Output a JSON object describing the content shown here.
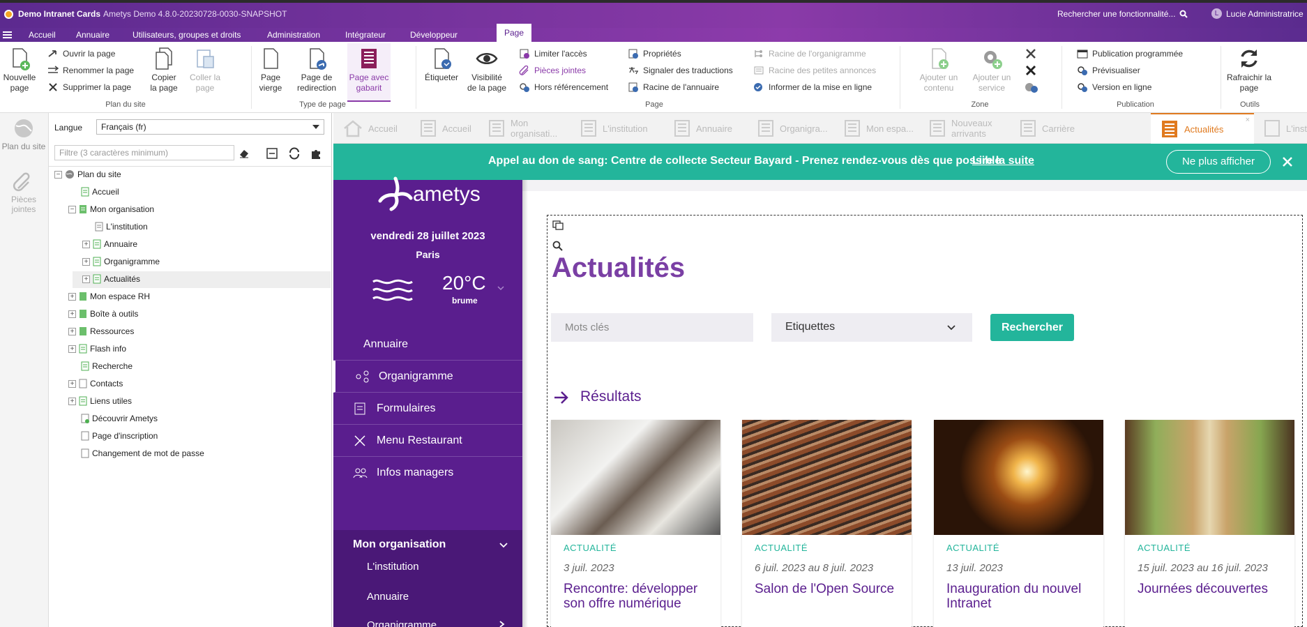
{
  "titlebar": {
    "app_name": "Demo Intranet Cards",
    "version": "Ametys Demo 4.8.0-20230728-0030-SNAPSHOT",
    "search_placeholder": "Rechercher une fonctionnalité...",
    "user_initial": "L",
    "user_name": "Lucie Administratrice"
  },
  "menu": {
    "items": [
      "Accueil",
      "Annuaire",
      "Utilisateurs, groupes et droits",
      "Administration",
      "Intégrateur",
      "Développeur"
    ],
    "active_tab": "Page"
  },
  "ribbon": {
    "plan": {
      "new_page": "Nouvelle page",
      "open": "Ouvrir la page",
      "rename": "Renommer la page",
      "delete": "Supprimer la page",
      "copy": "Copier la page",
      "paste": "Coller la page",
      "group": "Plan du site"
    },
    "type": {
      "blank": "Page vierge",
      "redirect": "Page de redirection",
      "template": "Page avec gabarit",
      "group": "Type de page"
    },
    "page": {
      "tag": "Étiqueter",
      "visibility": "Visibilité de la page",
      "limit_access": "Limiter l'accès",
      "attachments": "Pièces jointes",
      "no_ref": "Hors référencement",
      "properties": "Propriétés",
      "translations": "Signaler des traductions",
      "directory_root": "Racine de l'annuaire",
      "org_root": "Racine de l'organigramme",
      "ads_root": "Racine des petites annonces",
      "notify_online": "Informer de la mise en ligne",
      "group": "Page"
    },
    "zone": {
      "add_content": "Ajouter un contenu",
      "add_service": "Ajouter un service",
      "group": "Zone"
    },
    "publication": {
      "scheduled": "Publication programmée",
      "preview": "Prévisualiser",
      "online": "Version en ligne",
      "group": "Publication"
    },
    "tools": {
      "refresh": "Rafraichir la page",
      "group": "Outils"
    }
  },
  "sidebar": {
    "sitemap": "Plan du site",
    "attachments": "Pièces jointes"
  },
  "tree_panel": {
    "language_label": "Langue",
    "language_value": "Français (fr)",
    "filter_placeholder": "Filtre (3 caractères minimum)",
    "nodes": [
      {
        "label": "Plan du site"
      },
      {
        "label": "Accueil"
      },
      {
        "label": "Mon organisation"
      },
      {
        "label": "L'institution"
      },
      {
        "label": "Annuaire"
      },
      {
        "label": "Organigramme"
      },
      {
        "label": "Actualités"
      },
      {
        "label": "Mon espace RH"
      },
      {
        "label": "Boîte à outils"
      },
      {
        "label": "Ressources"
      },
      {
        "label": "Flash info"
      },
      {
        "label": "Recherche"
      },
      {
        "label": "Contacts"
      },
      {
        "label": "Liens utiles"
      },
      {
        "label": "Découvrir Ametys"
      },
      {
        "label": "Page d'inscription"
      },
      {
        "label": "Changement de mot de passe"
      }
    ]
  },
  "tabs": [
    "Accueil",
    "Accueil",
    "Mon organisati...",
    "L'institution",
    "Annuaire",
    "Organigra...",
    "Mon espa...",
    "Nouveaux arrivants",
    "Carrière",
    "Actualités",
    "L'institu..."
  ],
  "banner": {
    "text": "Appel au don de sang: Centre de collecte Secteur Bayard - Prenez rendez-vous dès que possible",
    "link": "Lire la suite",
    "dismiss": "Ne plus afficher"
  },
  "site": {
    "logo": "ametys",
    "date": "vendredi 28 juillet 2023",
    "city": "Paris",
    "temperature": "20°C",
    "weather": "brume",
    "nav": [
      "Annuaire",
      "Organigramme",
      "Formulaires",
      "Menu Restaurant",
      "Infos managers"
    ],
    "section_title": "Mon organisation",
    "section_items": [
      "L'institution",
      "Annuaire",
      "Organigramme"
    ],
    "page_title": "Actualités",
    "keywords_placeholder": "Mots clés",
    "tags_select": "Etiquettes",
    "search_button": "Rechercher",
    "results_title": "Résultats",
    "cards": [
      {
        "category": "ACTUALITÉ",
        "date": "3 juil. 2023",
        "title": "Rencontre: développer son offre numérique"
      },
      {
        "category": "ACTUALITÉ",
        "date": "6 juil. 2023 au 8 juil. 2023",
        "title": "Salon de l'Open Source"
      },
      {
        "category": "ACTUALITÉ",
        "date": "13 juil. 2023",
        "title": "Inauguration du nouvel Intranet"
      },
      {
        "category": "ACTUALITÉ",
        "date": "15 juil. 2023 au 16 juil. 2023",
        "title": "Journées découvertes"
      }
    ]
  },
  "colors": {
    "brand_purple": "#5a1e8e",
    "accent_teal": "#23b59b",
    "active_tab": "#e07a1f"
  }
}
